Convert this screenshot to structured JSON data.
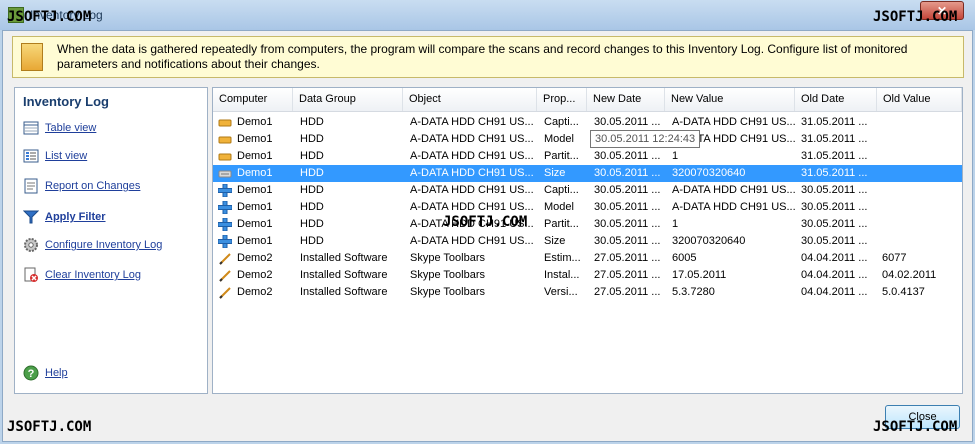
{
  "window": {
    "title": "Inventory Log"
  },
  "info": {
    "text": "When the data is gathered repeatedly from computers, the program will compare the scans and record changes to this Inventory Log. Configure list of monitored parameters and notifications about their changes."
  },
  "sidebar": {
    "title": "Inventory Log",
    "items": [
      {
        "label": "Table view",
        "icon": "table-view-icon"
      },
      {
        "label": "List view",
        "icon": "list-view-icon"
      },
      {
        "label": "Report on Changes",
        "icon": "report-icon"
      },
      {
        "label": "Apply Filter",
        "icon": "filter-icon"
      },
      {
        "label": "Configure Inventory Log",
        "icon": "gear-icon"
      },
      {
        "label": "Clear Inventory Log",
        "icon": "clear-log-icon"
      }
    ],
    "help": {
      "label": "Help",
      "icon": "help-icon"
    }
  },
  "table": {
    "columns": [
      "Computer",
      "Data Group",
      "Object",
      "Prop...",
      "New Date",
      "New Value",
      "Old Date",
      "Old Value"
    ],
    "rows": [
      {
        "icon": "changed-icon",
        "cells": [
          "Demo1",
          "HDD",
          "A-DATA HDD CH91 US...",
          "Capti...",
          "30.05.2011 ...",
          "A-DATA HDD CH91 US...",
          "31.05.2011 ...",
          ""
        ]
      },
      {
        "icon": "changed-icon",
        "cells": [
          "Demo1",
          "HDD",
          "A-DATA HDD CH91 US...",
          "Model",
          "30.05.2011 ...",
          "A-DATA HDD CH91 US...",
          "31.05.2011 ...",
          ""
        ]
      },
      {
        "icon": "changed-icon",
        "cells": [
          "Demo1",
          "HDD",
          "A-DATA HDD CH91 US...",
          "Partit...",
          "30.05.2011 ...",
          "1",
          "31.05.2011 ...",
          ""
        ]
      },
      {
        "icon": "removed-icon",
        "cells": [
          "Demo1",
          "HDD",
          "A-DATA HDD CH91 US...",
          "Size",
          "30.05.2011 ...",
          "320070320640",
          "31.05.2011 ...",
          ""
        ],
        "selected": true
      },
      {
        "icon": "added-icon",
        "cells": [
          "Demo1",
          "HDD",
          "A-DATA HDD CH91 US...",
          "Capti...",
          "30.05.2011 ...",
          "A-DATA HDD CH91 US...",
          "30.05.2011 ...",
          ""
        ]
      },
      {
        "icon": "added-icon",
        "cells": [
          "Demo1",
          "HDD",
          "A-DATA HDD CH91 US...",
          "Model",
          "30.05.2011 ...",
          "A-DATA HDD CH91 US...",
          "30.05.2011 ...",
          ""
        ]
      },
      {
        "icon": "added-icon",
        "cells": [
          "Demo1",
          "HDD",
          "A-DATA HDD CH91 US...",
          "Partit...",
          "30.05.2011 ...",
          "1",
          "30.05.2011 ...",
          ""
        ]
      },
      {
        "icon": "added-icon",
        "cells": [
          "Demo1",
          "HDD",
          "A-DATA HDD CH91 US...",
          "Size",
          "30.05.2011 ...",
          "320070320640",
          "30.05.2011 ...",
          ""
        ]
      },
      {
        "icon": "edit-icon",
        "cells": [
          "Demo2",
          "Installed Software",
          "Skype Toolbars",
          "Estim...",
          "27.05.2011 ...",
          "6005",
          "04.04.2011 ...",
          "6077"
        ]
      },
      {
        "icon": "edit-icon",
        "cells": [
          "Demo2",
          "Installed Software",
          "Skype Toolbars",
          "Instal...",
          "27.05.2011 ...",
          "17.05.2011",
          "04.04.2011 ...",
          "04.02.2011"
        ]
      },
      {
        "icon": "edit-icon",
        "cells": [
          "Demo2",
          "Installed Software",
          "Skype Toolbars",
          "Versi...",
          "27.05.2011 ...",
          "5.3.7280",
          "04.04.2011 ...",
          "5.0.4137"
        ]
      }
    ],
    "tooltip": "30.05.2011 12:24:43"
  },
  "footer": {
    "close_label": "Close"
  },
  "watermark": "JSOFTJ.COM"
}
